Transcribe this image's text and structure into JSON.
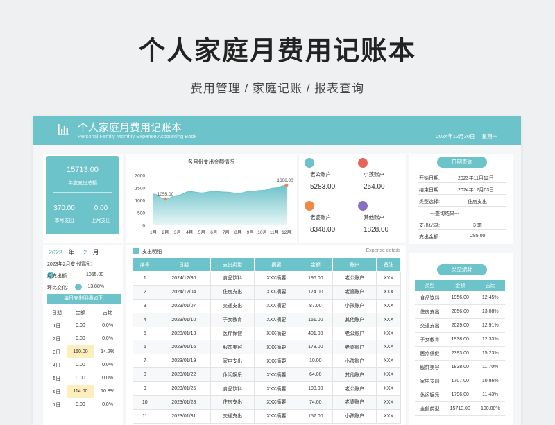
{
  "hero": {
    "title": "个人家庭月费用记账本",
    "subtitle": "费用管理 / 家庭记账 / 报表查询"
  },
  "banner": {
    "title": "个人家庭月费用记账本",
    "subtitle_en": "Personal Family Monthly Expense Accounting Book",
    "date": "2024年12月30日",
    "weekday": "星期一",
    "logo_icon": "bar-chart-icon"
  },
  "summary": {
    "annual_total": "15713.00",
    "annual_label": "年度支出总额",
    "this_month": "370.00",
    "this_month_label": "本月支出",
    "last_month": "0.00",
    "last_month_label": "上月支出"
  },
  "chart_data": {
    "type": "area",
    "title": "各月份支出金额情况",
    "categories": [
      "1月",
      "2月",
      "3月",
      "4月",
      "5月",
      "6月",
      "7月",
      "8月",
      "9月",
      "10月",
      "11月",
      "12月"
    ],
    "values": [
      1250,
      1055,
      1200,
      1350,
      1300,
      1360,
      1330,
      1280,
      1360,
      1400,
      1500,
      1606
    ],
    "ylim": [
      0,
      2000
    ],
    "yticks": [
      0,
      500,
      1000,
      1500,
      2000
    ],
    "data_labels": [
      {
        "index": 1,
        "text": "1055.00"
      },
      {
        "index": 11,
        "text": "1606.00"
      }
    ],
    "color": "#6cc3c9",
    "marker_color": "#e8884c"
  },
  "accounts": [
    {
      "name": "老公账户",
      "value": "5283.00",
      "color": "#6cc3c9",
      "icon": "bar-chart-icon"
    },
    {
      "name": "小孩账户",
      "value": "254.00",
      "color": "#e8635a",
      "icon": "document-icon"
    },
    {
      "name": "老婆账户",
      "value": "8348.00",
      "color": "#ee8a45",
      "icon": "person-icon"
    },
    {
      "name": "其他账户",
      "value": "1828.00",
      "color": "#8a6fc0",
      "icon": "people-icon"
    }
  ],
  "date_query": {
    "title": "日期查询",
    "start_label": "开始日期:",
    "start_value": "2023年11月12日",
    "end_label": "结束日期:",
    "end_value": "2024年12月03日",
    "type_label": "类型选择:",
    "type_value": "住房支出",
    "result_title": "---查询结果---",
    "count_label": "支出记录:",
    "count_value": "3 笔",
    "amount_label": "支出金额:",
    "amount_value": "285.00"
  },
  "month_select": {
    "year": "2023",
    "year_unit": "年",
    "month": "2",
    "month_unit": "月",
    "status_title": "2023年2月支出情况：",
    "month_spend_label": "月支出额:",
    "month_spend_value": "1055.00",
    "mom_label": "环比变化:",
    "mom_value": "-13.88%",
    "daily_title": "每日支出明细如下:",
    "headers": [
      "日期",
      "金额",
      "占比"
    ],
    "rows": [
      [
        "1日",
        "0.00",
        "0.0%"
      ],
      [
        "2日",
        "0.00",
        "0.0%"
      ],
      [
        "3日",
        "150.00",
        "14.2%"
      ],
      [
        "4日",
        "0.00",
        "0.0%"
      ],
      [
        "5日",
        "0.00",
        "0.0%"
      ],
      [
        "6日",
        "114.00",
        "10.8%"
      ],
      [
        "7日",
        "0.00",
        "0.0%"
      ]
    ]
  },
  "details": {
    "title": "支出明细",
    "title_en": "Expense details",
    "headers": [
      "序号",
      "日期",
      "支出类型",
      "摘要",
      "金额",
      "账户",
      "备注"
    ],
    "rows": [
      [
        "1",
        "2024/12/30",
        "食品饮料",
        "XXX摘要",
        "196.00",
        "老公账户",
        "XXX"
      ],
      [
        "2",
        "2024/12/04",
        "住房支出",
        "XXX摘要",
        "174.00",
        "老婆账户",
        "XXX"
      ],
      [
        "3",
        "2023/01/07",
        "交通支出",
        "XXX摘要",
        "87.00",
        "小孩账户",
        "XXX"
      ],
      [
        "4",
        "2023/01/10",
        "子女教育",
        "XXX摘要",
        "151.00",
        "其他账户",
        "XXX"
      ],
      [
        "5",
        "2023/01/13",
        "医疗保健",
        "XXX摘要",
        "401.00",
        "老公账户",
        "XXX"
      ],
      [
        "6",
        "2023/01/16",
        "服饰美容",
        "XXX摘要",
        "178.00",
        "老婆账户",
        "XXX"
      ],
      [
        "7",
        "2023/01/19",
        "家电支出",
        "XXX摘要",
        "10.00",
        "小孩账户",
        "XXX"
      ],
      [
        "8",
        "2023/01/22",
        "休闲娱乐",
        "XXX摘要",
        "64.00",
        "其他账户",
        "XXX"
      ],
      [
        "9",
        "2023/01/25",
        "食品饮料",
        "XXX摘要",
        "103.00",
        "老公账户",
        "XXX"
      ],
      [
        "10",
        "2023/01/28",
        "住房支出",
        "XXX摘要",
        "74.00",
        "老婆账户",
        "XXX"
      ],
      [
        "11",
        "2023/01/31",
        "交通支出",
        "XXX摘要",
        "157.00",
        "小孩账户",
        "XXX"
      ]
    ]
  },
  "type_stats": {
    "title": "类型统计",
    "headers": [
      "类型",
      "金额",
      "占比"
    ],
    "rows": [
      [
        "食品饮料",
        "1956.00",
        "12.45%"
      ],
      [
        "住房支出",
        "2056.00",
        "13.08%"
      ],
      [
        "交通支出",
        "2029.00",
        "12.91%"
      ],
      [
        "子女教育",
        "1938.00",
        "12.33%"
      ],
      [
        "医疗保健",
        "2393.00",
        "15.23%"
      ],
      [
        "服饰美容",
        "1838.00",
        "11.70%"
      ],
      [
        "家电支出",
        "1707.00",
        "10.86%"
      ],
      [
        "休闲娱乐",
        "1796.00",
        "11.43%"
      ],
      [
        "全部类型",
        "15713.00",
        "100.00%"
      ]
    ]
  }
}
